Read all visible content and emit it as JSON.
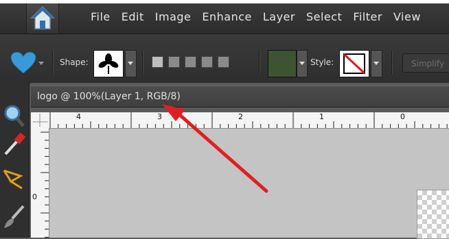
{
  "menubar": {
    "items": [
      "File",
      "Edit",
      "Image",
      "Enhance",
      "Layer",
      "Select",
      "Filter",
      "View"
    ]
  },
  "options": {
    "shape_label": "Shape:",
    "style_label": "Style:",
    "simplify_label": "Simplify",
    "fill_color": "#3d5433",
    "heart_color": "#3a9ad9"
  },
  "document": {
    "title": "logo @ 100%(Layer 1, RGB/8)"
  },
  "ruler": {
    "top_labels": [
      "4",
      "3",
      "2",
      "1",
      "0"
    ],
    "left_labels": [
      "0"
    ]
  },
  "annotation": {
    "arrow_color": "#e02020"
  }
}
